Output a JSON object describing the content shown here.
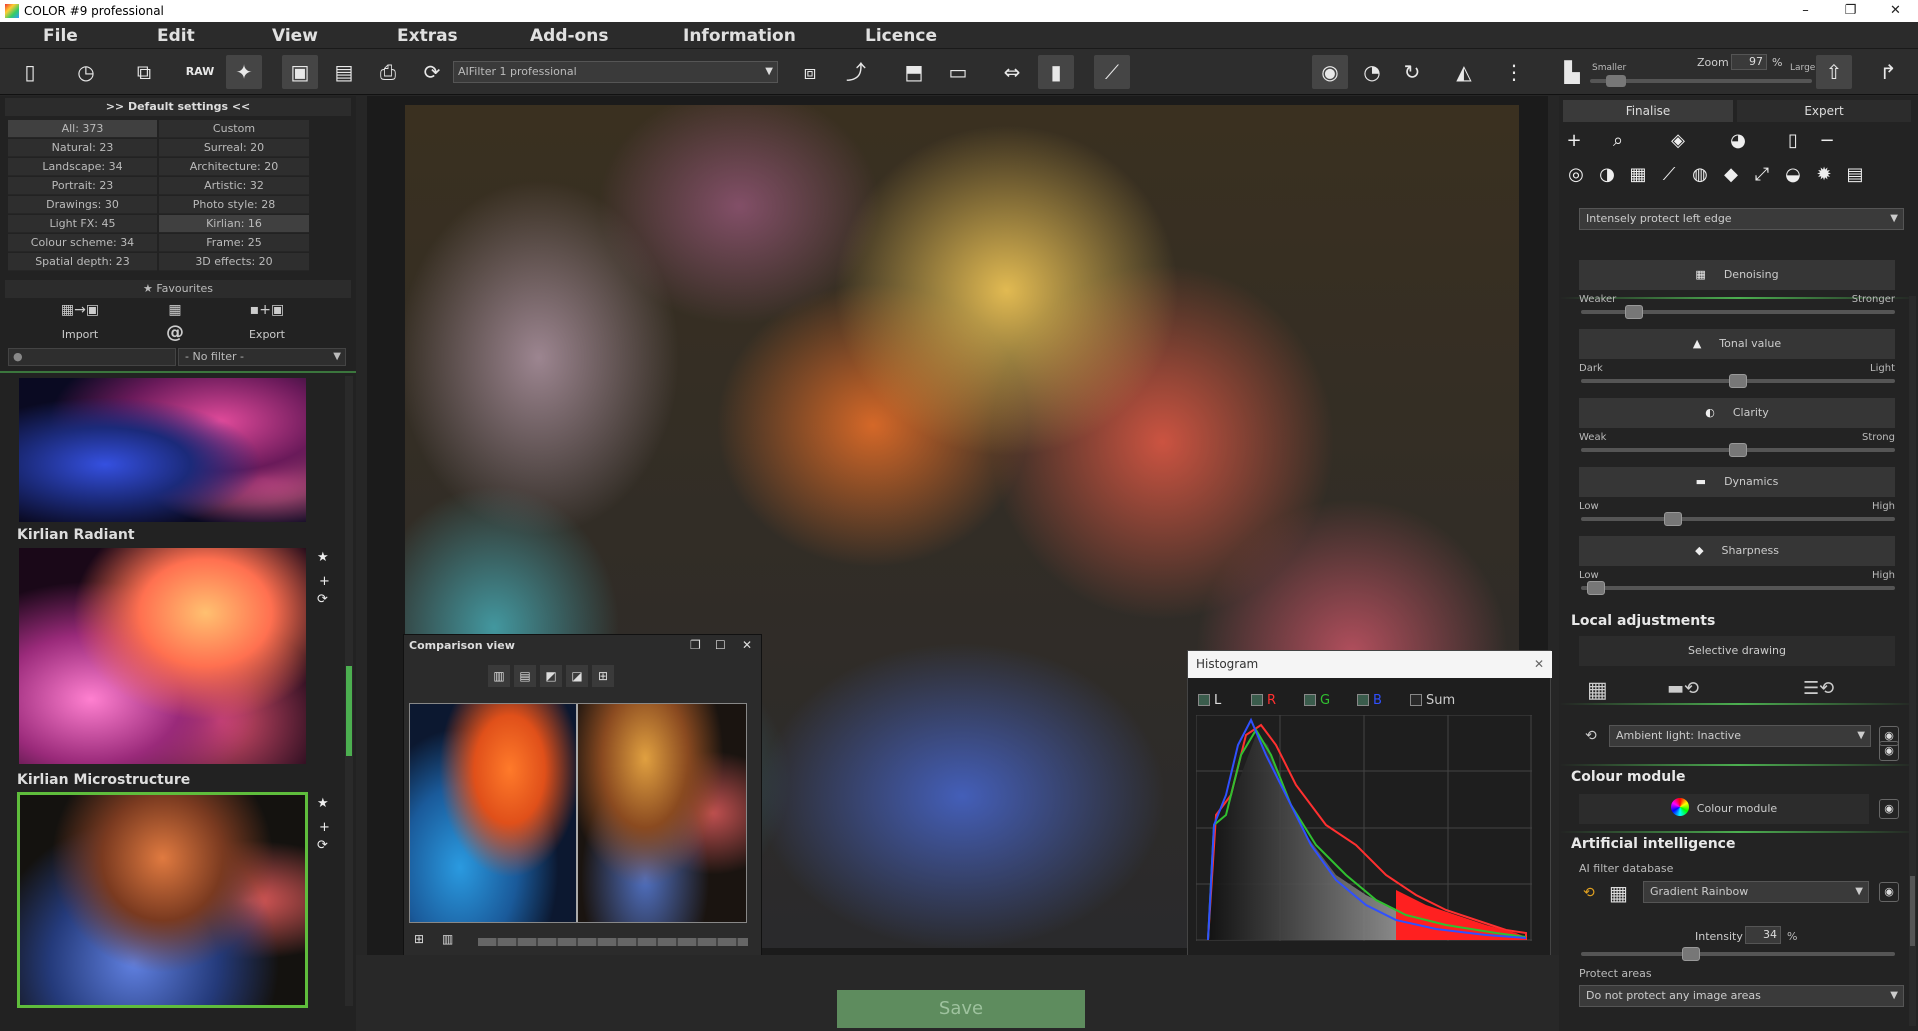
{
  "window": {
    "title": "COLOR #9 professional",
    "minimize": "–",
    "maximize": "❐",
    "close": "✕"
  },
  "menu": [
    "File",
    "Edit",
    "View",
    "Extras",
    "Add-ons",
    "Information",
    "Licence"
  ],
  "toolbar": {
    "icons": {
      "new": "▯",
      "history": "◷",
      "copy": "⧉",
      "raw": "RAW",
      "effects": "✦",
      "save": "▣",
      "saveas": "▤",
      "print": "⎙",
      "share": "⟳",
      "arrange": "⧈",
      "export": "⤴",
      "compare": "⬒",
      "crop": "▭",
      "flip": "⇔",
      "fit": "▮",
      "histogram": "⟋",
      "eye": "◉",
      "reset": "◔",
      "redo": "↻",
      "mirror": "◭",
      "dots": "⋮",
      "align": "▙",
      "ruler": "⇧",
      "exit": "↱"
    },
    "filter_select": "AIFilter 1 professional",
    "zoom": {
      "label": "Zoom",
      "value": "97",
      "unit": "%",
      "smaller": "Smaller",
      "larger": "Larger"
    }
  },
  "left": {
    "header": ">> Default settings <<",
    "categories": [
      [
        "All: 373",
        "Custom"
      ],
      [
        "Natural: 23",
        "Surreal: 20"
      ],
      [
        "Landscape: 34",
        "Architecture: 20"
      ],
      [
        "Portrait: 23",
        "Artistic: 32"
      ],
      [
        "Drawings: 30",
        "Photo style: 28"
      ],
      [
        "Light FX: 45",
        "Kirlian: 16"
      ],
      [
        "Colour scheme: 34",
        "Frame: 25"
      ],
      [
        "Spatial depth: 23",
        "3D effects: 20"
      ]
    ],
    "favourites": "★ Favourites",
    "import": "Import",
    "export": "Export",
    "at": "@",
    "import_icon": "▦→▣",
    "mid_icon": "▦",
    "export_icon": "▪+▣",
    "search_icon": "●",
    "filter": "- No filter -",
    "thumbs": [
      {
        "label": ""
      },
      {
        "label": "Kirlian Radiant"
      },
      {
        "label": "Kirlian Microstructure"
      }
    ],
    "star": "★",
    "plus": "+",
    "cycle": "⟳"
  },
  "save": "Save",
  "comparison": {
    "title": "Comparison view",
    "restore": "❐",
    "max": "☐",
    "close": "✕",
    "modes": [
      "▥",
      "▤",
      "◩",
      "◪",
      "⊞"
    ],
    "bottom": [
      "⊞",
      "▥"
    ]
  },
  "histogram": {
    "title": "Histogram",
    "close": "✕",
    "channels": [
      {
        "name": "L",
        "color": "#dddddd"
      },
      {
        "name": "R",
        "color": "#ff3030"
      },
      {
        "name": "G",
        "color": "#30c030"
      },
      {
        "name": "B",
        "color": "#3050ff"
      },
      {
        "name": "Sum",
        "color": "#cccccc"
      }
    ]
  },
  "right": {
    "tabs": [
      "Finalise",
      "Expert"
    ],
    "icons_row1": [
      "+",
      "⌕",
      "◈",
      "◕",
      "▯",
      "−"
    ],
    "icons_row2": [
      "◎",
      "◑",
      "▦",
      "⟋",
      "◍",
      "◆",
      "⤢",
      "◒",
      "✹",
      "▤"
    ],
    "protect_edge": "Intensely protect left edge",
    "sliders": [
      {
        "name": "Denoising",
        "icon": "▦",
        "left": "Weaker",
        "right": "Stronger",
        "value": 0.15
      },
      {
        "name": "Tonal value",
        "icon": "▲",
        "left": "Dark",
        "right": "Light",
        "value": 0.5
      },
      {
        "name": "Clarity",
        "icon": "◐",
        "left": "Weak",
        "right": "Strong",
        "value": 0.5
      },
      {
        "name": "Dynamics",
        "icon": "▬",
        "left": "Low",
        "right": "High",
        "value": 0.28
      },
      {
        "name": "Sharpness",
        "icon": "◆",
        "left": "Low",
        "right": "High",
        "value": 0.02
      }
    ],
    "local": {
      "title": "Local adjustments",
      "selective": "Selective drawing",
      "ambient": "Ambient light: Inactive"
    },
    "colour": {
      "title": "Colour module",
      "btn": "Colour module"
    },
    "ai": {
      "title": "Artificial intelligence",
      "db": "AI filter database",
      "select": "Gradient Rainbow",
      "intensity_label": "Intensity",
      "intensity": "34",
      "unit": "%",
      "intensity_value": 0.34,
      "protect_label": "Protect areas",
      "protect": "Do not protect any image areas"
    },
    "eye": "◉",
    "arrow": "▼"
  }
}
